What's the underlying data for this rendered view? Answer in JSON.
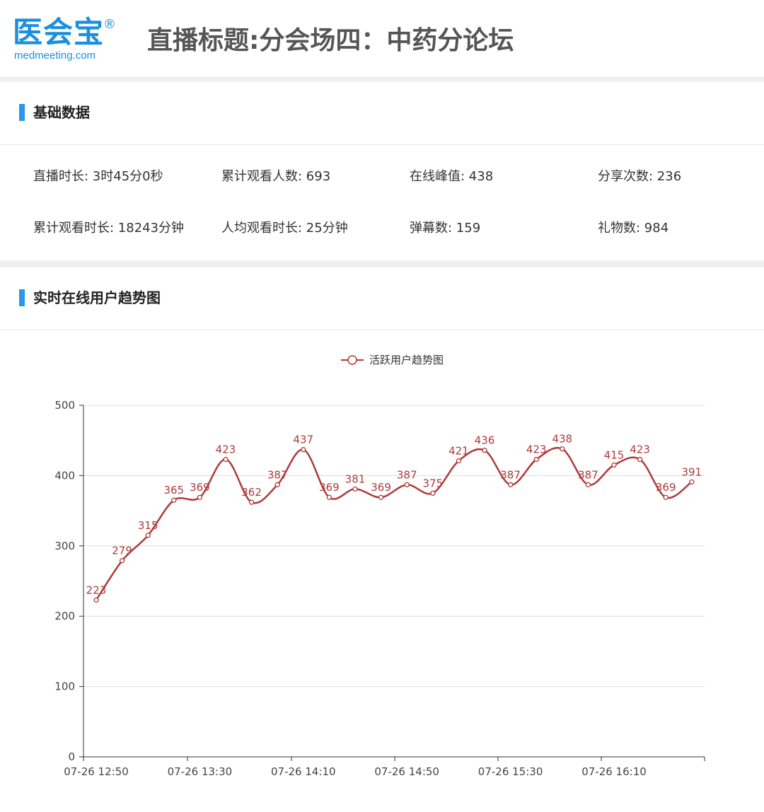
{
  "header": {
    "logo_cn": "医会宝",
    "logo_reg": "®",
    "logo_en": "medmeeting.com",
    "title": "直播标题:分会场四：中药分论坛"
  },
  "sections": {
    "basic": "基础数据",
    "trend": "实时在线用户趋势图"
  },
  "stats": [
    {
      "text": "直播时长: 3时45分0秒"
    },
    {
      "text": "累计观看人数: 693"
    },
    {
      "text": "在线峰值: 438"
    },
    {
      "text": "分享次数: 236"
    },
    {
      "text": "累计观看时长: 18243分钟"
    },
    {
      "text": "人均观看时长: 25分钟"
    },
    {
      "text": "弹幕数: 159"
    },
    {
      "text": "礼物数: 984"
    }
  ],
  "colors": {
    "accent": "#2b96ea",
    "logo": "#1a8fe0",
    "series": "#b03a3a",
    "grid": "#dddddd"
  },
  "chart_data": {
    "type": "line",
    "legend": "活跃用户趋势图",
    "legend_position": "top-center",
    "x_labels_visible": [
      "07-26 12:50",
      "07-26 13:30",
      "07-26 14:10",
      "07-26 14:50",
      "07-26 15:30",
      "07-26 16:10"
    ],
    "x": [
      "07-26 12:50",
      "07-26 13:00",
      "07-26 13:10",
      "07-26 13:20",
      "07-26 13:30",
      "07-26 13:40",
      "07-26 13:50",
      "07-26 14:00",
      "07-26 14:10",
      "07-26 14:20",
      "07-26 14:30",
      "07-26 14:40",
      "07-26 14:50",
      "07-26 15:00",
      "07-26 15:10",
      "07-26 15:20",
      "07-26 15:30",
      "07-26 15:40",
      "07-26 15:50",
      "07-26 16:00",
      "07-26 16:10",
      "07-26 16:20",
      "07-26 16:30",
      "07-26 16:40"
    ],
    "series": [
      {
        "name": "活跃用户趋势图",
        "values": [
          223,
          279,
          315,
          365,
          369,
          423,
          362,
          387,
          437,
          369,
          381,
          369,
          387,
          375,
          421,
          436,
          387,
          423,
          438,
          387,
          415,
          423,
          369,
          391
        ]
      }
    ],
    "ylim": [
      0,
      500
    ],
    "yticks": [
      0,
      100,
      200,
      300,
      400,
      500
    ],
    "grid": true
  }
}
